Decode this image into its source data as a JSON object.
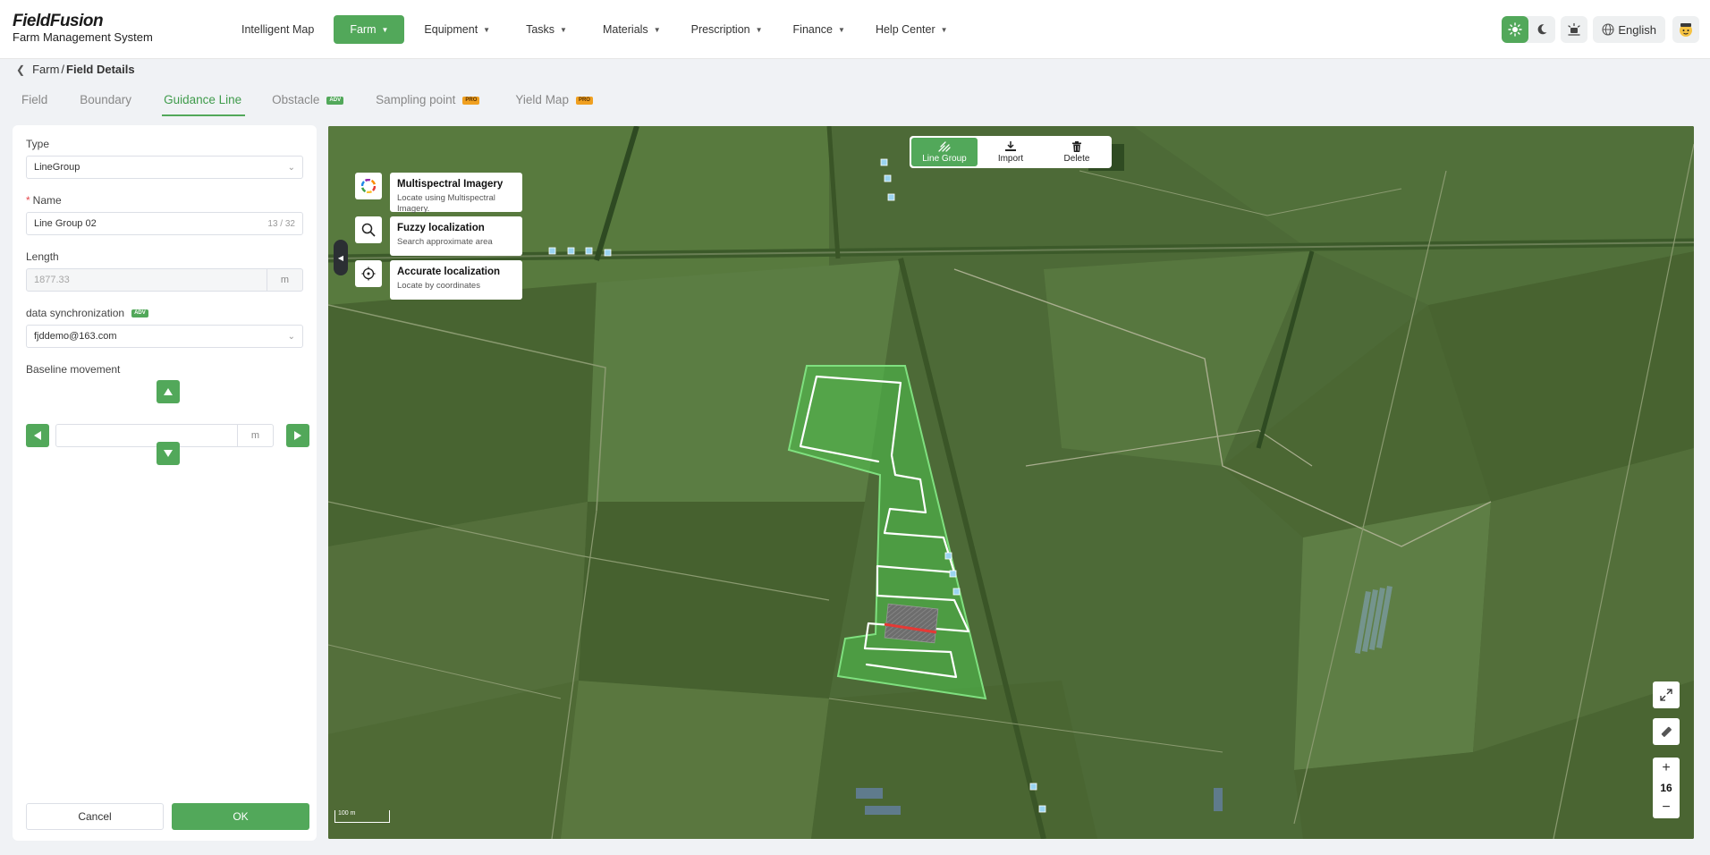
{
  "app": {
    "name": "FieldFusion",
    "subtitle": "Farm Management System"
  },
  "nav": {
    "items": [
      {
        "label": "Intelligent Map",
        "has_caret": false
      },
      {
        "label": "Farm",
        "has_caret": true,
        "active": true
      },
      {
        "label": "Equipment",
        "has_caret": true
      },
      {
        "label": "Tasks",
        "has_caret": true
      },
      {
        "label": "Materials",
        "has_caret": true
      },
      {
        "label": "Prescription",
        "has_caret": true
      },
      {
        "label": "Finance",
        "has_caret": true
      },
      {
        "label": "Help Center",
        "has_caret": true
      }
    ],
    "language": "English"
  },
  "breadcrumb": {
    "parent": "Farm",
    "separator": "/",
    "current": "Field Details"
  },
  "tabs": [
    {
      "label": "Field"
    },
    {
      "label": "Boundary"
    },
    {
      "label": "Guidance Line",
      "active": true
    },
    {
      "label": "Obstacle",
      "badge": "ADV"
    },
    {
      "label": "Sampling point",
      "badge": "PRO"
    },
    {
      "label": "Yield Map",
      "badge": "PRO"
    }
  ],
  "form": {
    "type_label": "Type",
    "type_value": "LineGroup",
    "name_label": "Name",
    "name_required": "*",
    "name_value": "Line Group 02",
    "name_count": "13 / 32",
    "length_label": "Length",
    "length_value": "1877.33",
    "length_unit": "m",
    "sync_label": "data synchronization",
    "sync_badge": "ADV",
    "sync_value": "fjddemo@163.com",
    "baseline_label": "Baseline movement",
    "baseline_value": "",
    "baseline_unit": "m",
    "cancel": "Cancel",
    "ok": "OK"
  },
  "map": {
    "toolbar": {
      "line_group": "Line Group",
      "import": "Import",
      "delete": "Delete"
    },
    "locate": [
      {
        "title": "Multispectral Imagery",
        "desc": "Locate using Multispectral Imagery.",
        "icon": "color-wheel-icon"
      },
      {
        "title": "Fuzzy localization",
        "desc": "Search approximate area",
        "icon": "search-icon"
      },
      {
        "title": "Accurate localization",
        "desc": "Locate by coordinates",
        "icon": "crosshair-icon"
      }
    ],
    "zoom_level": "16",
    "scale_label": "100 m"
  },
  "colors": {
    "accent": "#52a85a",
    "field_fill": "#4fc44f",
    "guide_line": "#ffffff",
    "baseline": "#e53935"
  }
}
